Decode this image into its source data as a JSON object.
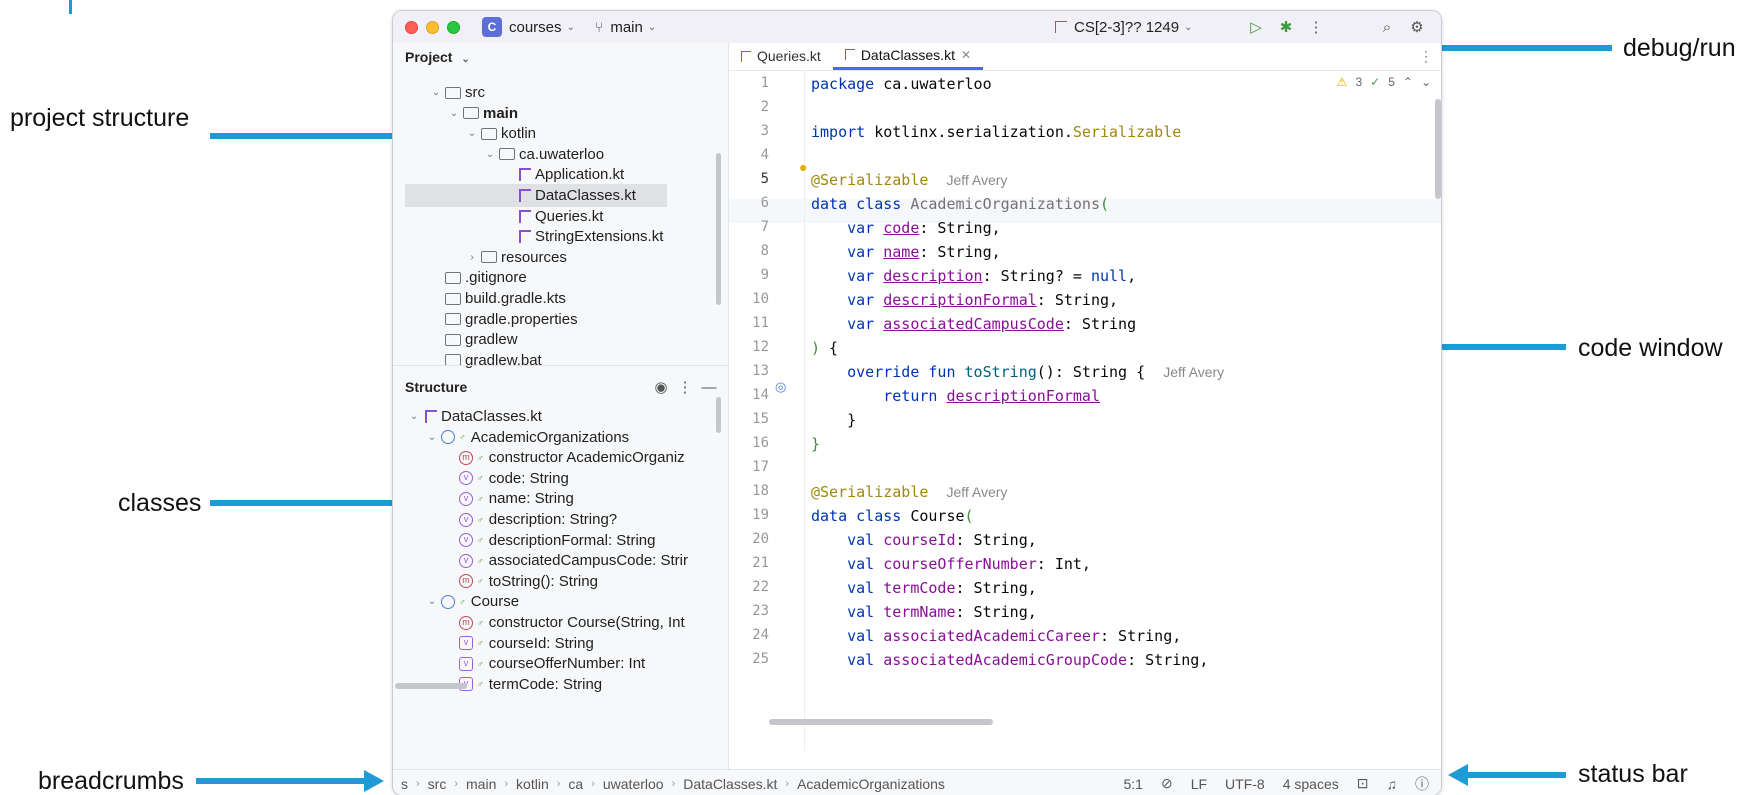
{
  "annotations": {
    "project_structure": "project structure",
    "classes": "classes",
    "breadcrumbs": "breadcrumbs",
    "debug_run": "debug/run",
    "code_window": "code window",
    "status_bar": "status bar"
  },
  "titlebar": {
    "project_badge": "C",
    "project_name": "courses",
    "branch": "main",
    "run_config": "CS[2-3]?? 1249"
  },
  "project_panel": {
    "title": "Project",
    "tree": [
      {
        "label": "src",
        "icon": "folder-icon",
        "chevron": "⌄"
      },
      {
        "label": "main",
        "icon": "source-folder-icon",
        "chevron": "⌄",
        "bold": true
      },
      {
        "label": "kotlin",
        "icon": "folder-icon",
        "chevron": "⌄"
      },
      {
        "label": "ca.uwaterloo",
        "icon": "package-icon",
        "chevron": "⌄"
      },
      {
        "label": "Application.kt",
        "icon": "kotlin-file-icon"
      },
      {
        "label": "DataClasses.kt",
        "icon": "kotlin-file-icon",
        "selected": true
      },
      {
        "label": "Queries.kt",
        "icon": "kotlin-file-icon"
      },
      {
        "label": "StringExtensions.kt",
        "icon": "kotlin-file-icon"
      },
      {
        "label": "resources",
        "icon": "resources-folder-icon",
        "chevron": "›"
      },
      {
        "label": ".gitignore",
        "icon": "ignore-icon"
      },
      {
        "label": "build.gradle.kts",
        "icon": "gradle-icon"
      },
      {
        "label": "gradle.properties",
        "icon": "settings-file-icon"
      },
      {
        "label": "gradlew",
        "icon": "terminal-file-icon"
      },
      {
        "label": "gradlew.bat",
        "icon": "text-file-icon"
      }
    ]
  },
  "structure_panel": {
    "title": "Structure",
    "tree": [
      {
        "label": "DataClasses.kt",
        "icon": "kotlin-file-icon",
        "chevron": "⌄"
      },
      {
        "label": "AcademicOrganizations",
        "icon": "class-icon",
        "chevron": "⌄"
      },
      {
        "label": "constructor AcademicOrganiz",
        "icon": "method-icon",
        "glyph": "m"
      },
      {
        "label": "code: String",
        "icon": "variable-icon",
        "glyph": "v"
      },
      {
        "label": "name: String",
        "icon": "variable-icon",
        "glyph": "v"
      },
      {
        "label": "description: String?",
        "icon": "variable-icon",
        "glyph": "v"
      },
      {
        "label": "descriptionFormal: String",
        "icon": "variable-icon",
        "glyph": "v"
      },
      {
        "label": "associatedCampusCode: Strir",
        "icon": "variable-icon",
        "glyph": "v"
      },
      {
        "label": "toString(): String",
        "icon": "method-icon",
        "glyph": "m"
      },
      {
        "label": "Course",
        "icon": "class-icon",
        "chevron": "⌄"
      },
      {
        "label": "constructor Course(String, Int",
        "icon": "method-icon",
        "glyph": "m"
      },
      {
        "label": "courseId: String",
        "icon": "value-icon",
        "glyph": "v"
      },
      {
        "label": "courseOfferNumber: Int",
        "icon": "value-icon",
        "glyph": "v"
      },
      {
        "label": "termCode: String",
        "icon": "value-icon",
        "glyph": "v"
      }
    ]
  },
  "editor": {
    "tabs": [
      {
        "label": "Queries.kt",
        "active": false
      },
      {
        "label": "DataClasses.kt",
        "active": true
      }
    ],
    "inspections": {
      "warnings": "3",
      "checks": "5"
    },
    "line_numbers": [
      "1",
      "2",
      "3",
      "4",
      "5",
      "6",
      "7",
      "8",
      "9",
      "10",
      "11",
      "12",
      "13",
      "14",
      "15",
      "16",
      "17",
      "18",
      "19",
      "20",
      "21",
      "22",
      "23",
      "24",
      "25"
    ],
    "author": "Jeff Avery"
  },
  "statusbar": {
    "breadcrumbs": [
      "s",
      "src",
      "main",
      "kotlin",
      "ca",
      "uwaterloo",
      "DataClasses.kt",
      "AcademicOrganizations"
    ],
    "position": "5:1",
    "line_ending": "LF",
    "encoding": "UTF-8",
    "indent": "4 spaces"
  },
  "colors": {
    "accent": "#1e9ad6",
    "keyword": "#0033b3",
    "annotation": "#9e880d",
    "property": "#871094",
    "function": "#00627a",
    "tab_underline": "#3574f0"
  }
}
